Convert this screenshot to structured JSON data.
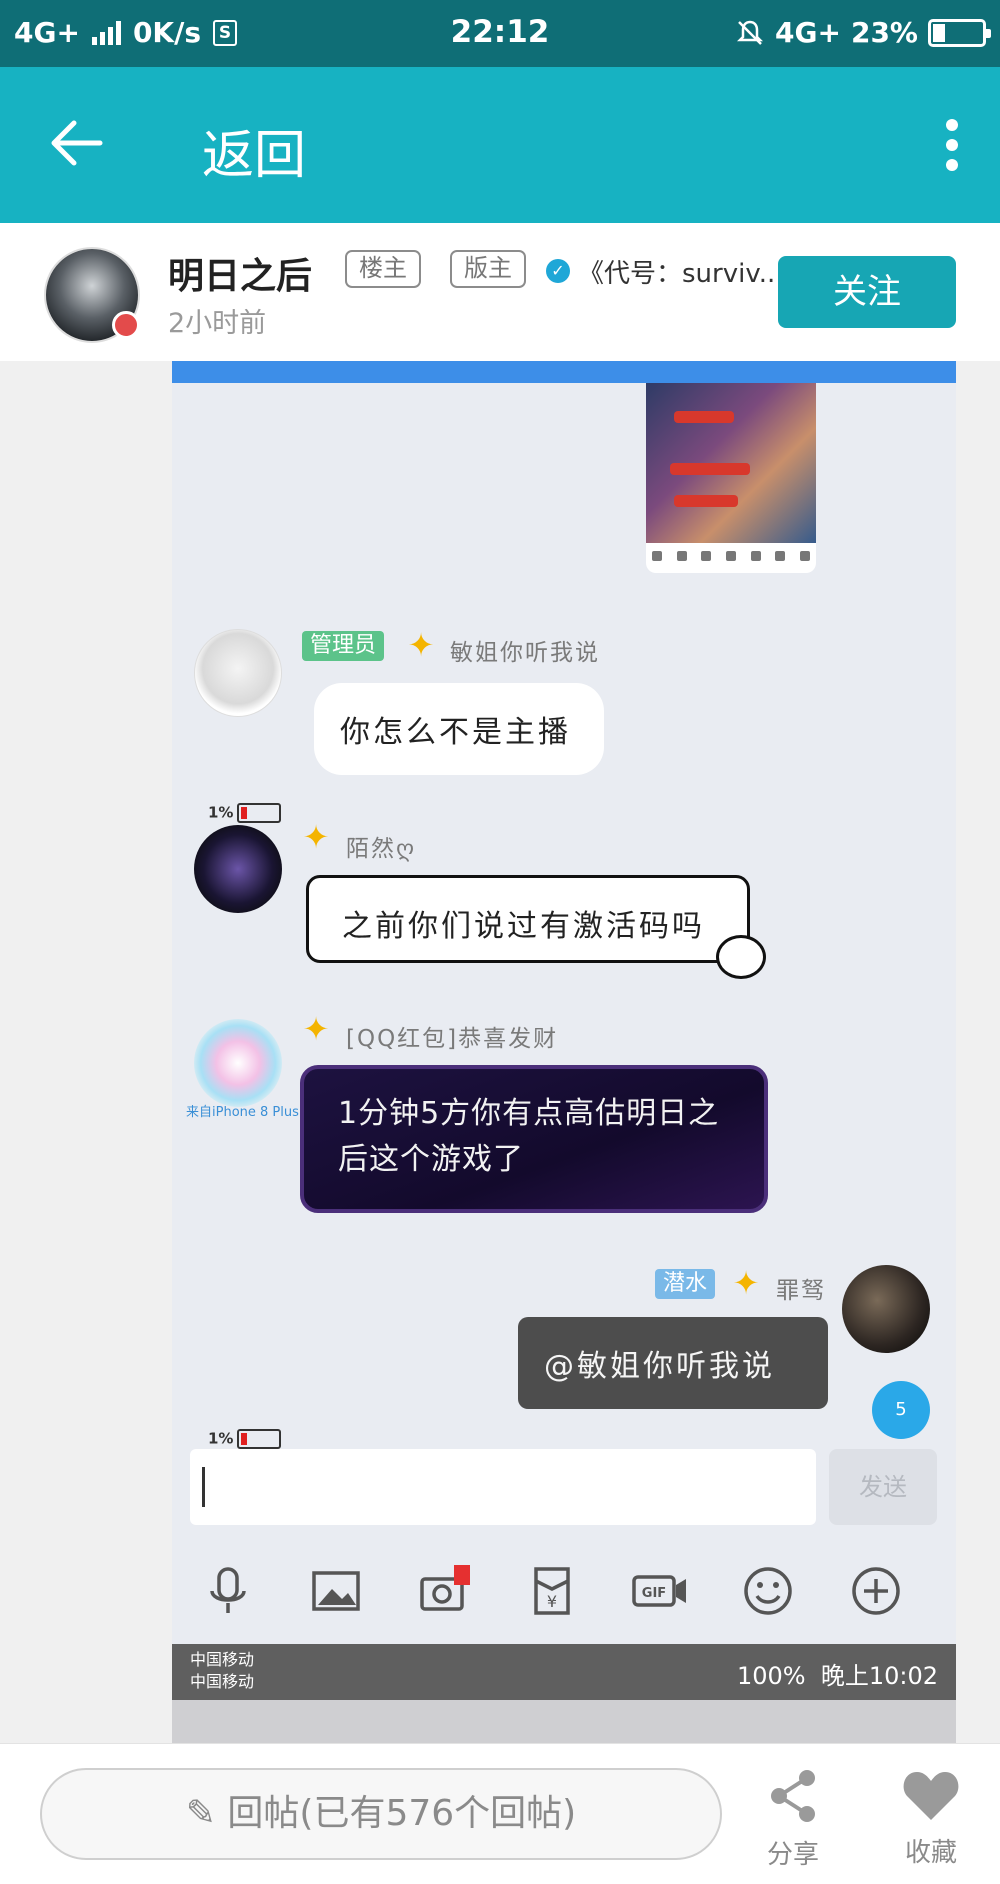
{
  "statusbar": {
    "network": "4G+",
    "speed": "0K/s",
    "time": "22:12",
    "right_network": "4G+",
    "battery": "23%",
    "battery_level": 0.23
  },
  "appbar": {
    "back_label": "返回"
  },
  "poster": {
    "name": "明日之后",
    "tag_owner": "楼主",
    "tag_mod": "版主",
    "forum": "《代号：surviv...",
    "time": "2小时前",
    "follow_label": "关注"
  },
  "screenshot": {
    "messages": [
      {
        "role": "管理员",
        "name": "敏姐你听我说",
        "text": "你怎么不是主播"
      },
      {
        "battery": "1%",
        "name": "陌然ღ",
        "text": "之前你们说过有激活码吗"
      },
      {
        "name": "[QQ红包]恭喜发财",
        "device": "来自iPhone 8 Plus",
        "text": "1分钟5方你有点高估明日之后这个游戏了"
      },
      {
        "role": "潜水",
        "name": "罪驽",
        "text": "@敏姐你听我说",
        "badge": "5"
      }
    ],
    "send_label": "发送",
    "battery_bottom": "1%",
    "tools": [
      "mic-icon",
      "image-icon",
      "camera-icon",
      "redpacket-icon",
      "gif-icon",
      "emoji-icon",
      "plus-icon"
    ],
    "inner_status": {
      "carrier1": "中国移动",
      "carrier2": "中国移动",
      "battery": "100%",
      "time": "晚上10:02"
    }
  },
  "bottombar": {
    "reply_label": "回帖(已有576个回帖)",
    "share_label": "分享",
    "fav_label": "收藏"
  }
}
